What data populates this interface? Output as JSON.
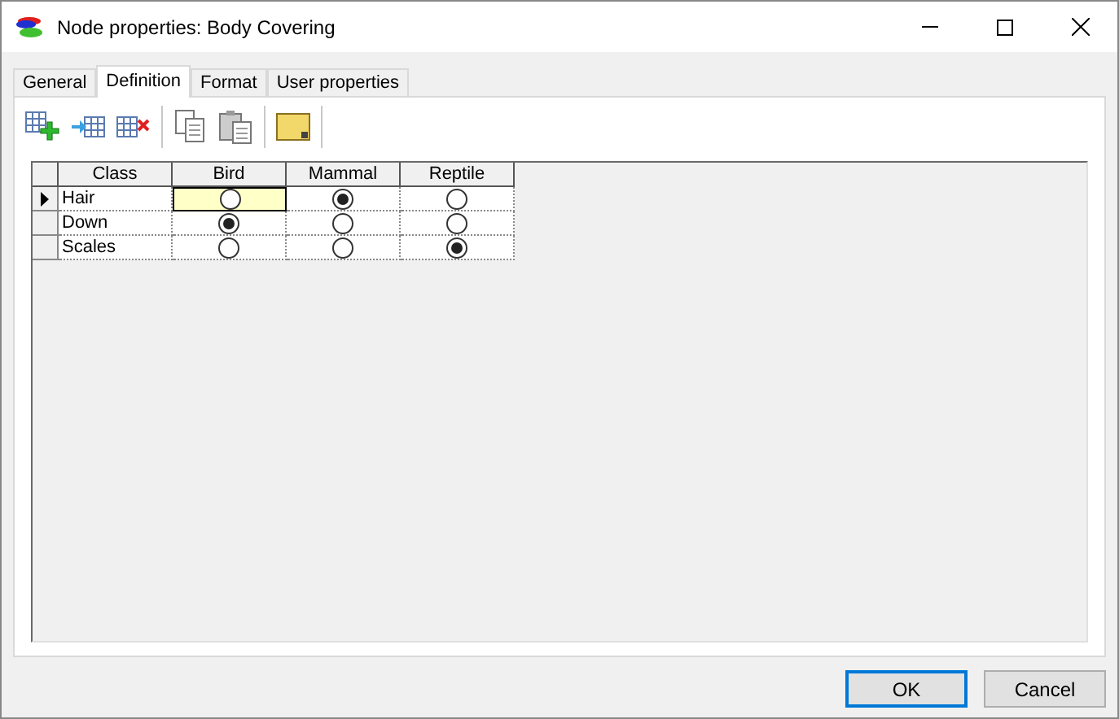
{
  "window": {
    "title": "Node properties: Body Covering"
  },
  "tabs": [
    {
      "label": "General",
      "selected": false
    },
    {
      "label": "Definition",
      "selected": true
    },
    {
      "label": "Format",
      "selected": false
    },
    {
      "label": "User properties",
      "selected": false
    }
  ],
  "table": {
    "columns": [
      "Class",
      "Bird",
      "Mammal",
      "Reptile"
    ],
    "rows": [
      {
        "label": "Hair",
        "selected": true,
        "cells": [
          {
            "checked": false,
            "focused": true
          },
          {
            "checked": true,
            "focused": false
          },
          {
            "checked": false,
            "focused": false
          }
        ]
      },
      {
        "label": "Down",
        "selected": false,
        "cells": [
          {
            "checked": true,
            "focused": false
          },
          {
            "checked": false,
            "focused": false
          },
          {
            "checked": false,
            "focused": false
          }
        ]
      },
      {
        "label": "Scales",
        "selected": false,
        "cells": [
          {
            "checked": false,
            "focused": false
          },
          {
            "checked": false,
            "focused": false
          },
          {
            "checked": true,
            "focused": false
          }
        ]
      }
    ]
  },
  "buttons": [
    {
      "label": "OK",
      "default": true
    },
    {
      "label": "Cancel",
      "default": false
    }
  ]
}
